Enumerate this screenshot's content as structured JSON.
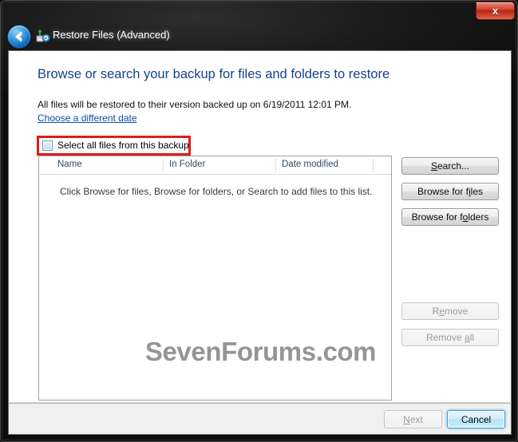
{
  "window": {
    "title": "Restore Files (Advanced)",
    "close_label": "x",
    "back_icon": "back-arrow-icon",
    "nav_icon": "restore-files-icon"
  },
  "content": {
    "heading": "Browse or search your backup for files and folders to restore",
    "restore_info": "All files will be restored to their version backed up on 6/19/2011 12:01 PM.",
    "choose_date_link": "Choose a different date",
    "select_all_label": "Select all files from this backup",
    "select_all_checked": false
  },
  "file_list": {
    "columns": [
      {
        "label": "Name"
      },
      {
        "label": "In Folder"
      },
      {
        "label": "Date modified"
      }
    ],
    "empty_message": "Click Browse for files, Browse for folders, or Search to add files to this list.",
    "rows": []
  },
  "watermark": "SevenForums.com",
  "side_buttons": [
    {
      "id": "search",
      "label_pre": "",
      "accel": "S",
      "label_post": "earch...",
      "disabled": false
    },
    {
      "id": "browse-files",
      "label_pre": "Browse for f",
      "accel": "i",
      "label_post": "les",
      "disabled": false
    },
    {
      "id": "browse-folders",
      "label_pre": "Browse for f",
      "accel": "o",
      "label_post": "lders",
      "disabled": false
    },
    {
      "id": "remove",
      "label_pre": "R",
      "accel": "e",
      "label_post": "move",
      "disabled": true
    },
    {
      "id": "remove-all",
      "label_pre": "Remove ",
      "accel": "a",
      "label_post": "ll",
      "disabled": true
    }
  ],
  "footer": {
    "next": {
      "label_pre": "",
      "accel": "N",
      "label_post": "ext",
      "disabled": true
    },
    "cancel": {
      "label": "Cancel",
      "default": true
    }
  },
  "colors": {
    "heading": "#14428c",
    "link": "#0b4ea2",
    "annotation": "#e01b1b",
    "close_button": "#b82613",
    "watermark": "#8d8d8d",
    "column_header_text": "#2b4a68"
  }
}
